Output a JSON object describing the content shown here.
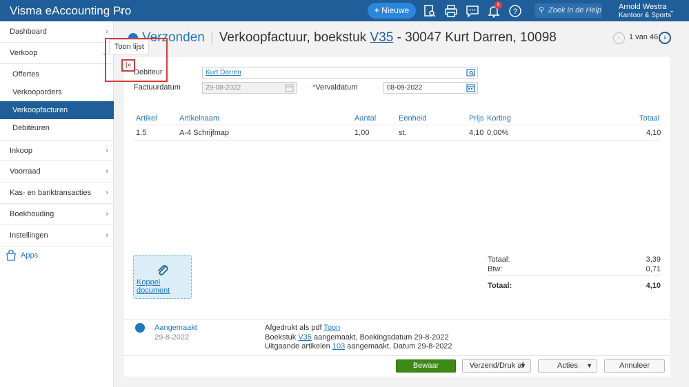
{
  "app": {
    "title": "Visma eAccounting Pro"
  },
  "topbar": {
    "new_label": "Nieuwe",
    "notifications_count": "5",
    "search_placeholder": "Zoek in de Help",
    "user_name": "Arnold Westra",
    "user_org": "Kantoor & Sports"
  },
  "sidebar": {
    "items": [
      {
        "label": "Dashboard"
      },
      {
        "label": "Verkoop"
      },
      {
        "label": "Inkoop"
      },
      {
        "label": "Voorraad"
      },
      {
        "label": "Kas- en banktransacties"
      },
      {
        "label": "Boekhouding"
      },
      {
        "label": "Instellingen"
      }
    ],
    "sub_items": [
      {
        "label": "Offertes"
      },
      {
        "label": "Verkooporders"
      },
      {
        "label": "Verkoopfacturen"
      },
      {
        "label": "Debiteuren"
      }
    ],
    "apps_label": "Apps"
  },
  "tooltip": {
    "text": "Toon lijst"
  },
  "header": {
    "crumb": "Verzonden",
    "title_prefix": "Verkoopfactuur, boekstuk",
    "voucher": "V35",
    "title_suffix": "- 30047 Kurt Darren, 10098",
    "pager": "1 van 46"
  },
  "form": {
    "debiteur_label": "Debiteur",
    "debiteur_value": "Kurt Darren",
    "factuurdatum_label": "Factuurdatum",
    "factuurdatum_value": "29-08-2022",
    "vervaldatum_label": "Vervaldatum",
    "vervaldatum_value": "08-09-2022"
  },
  "table": {
    "headers": [
      "Artikel",
      "Artikelnaam",
      "Aantal",
      "Eenheid",
      "Prijs",
      "Korting",
      "Totaal"
    ],
    "rows": [
      [
        "1.5",
        "A-4 Schrijfmap",
        "1,00",
        "st.",
        "4,10",
        "0,00%",
        "4,10"
      ]
    ]
  },
  "attach": {
    "label": "Koppel document"
  },
  "summary": {
    "subtotal_label": "Totaal:",
    "subtotal_value": "3,39",
    "vat_label": "Btw:",
    "vat_value": "0,71",
    "total_label": "Totaal:",
    "total_value": "4,10"
  },
  "history": {
    "status": "Aangemaakt",
    "date": "29-8-2022",
    "line1_text": "Afgedrukt als pdf",
    "line1_link": "Toon",
    "line2_pre": "Boekstuk",
    "line2_link": "V35",
    "line2_post": "aangemaakt, Boekingsdatum 29-8-2022",
    "line3_pre": "Uitgaande artikelen",
    "line3_link": "103",
    "line3_post": "aangemaakt, Datum 29-8-2022"
  },
  "footer": {
    "save_label": "Bewaar",
    "send_label": "Verzend/Druk af",
    "actions_label": "Acties",
    "cancel_label": "Annuleer"
  },
  "colors": {
    "brand": "#1f5e99",
    "link": "#1f77c3",
    "save": "#3c8a15",
    "highlight": "#d83a3a"
  }
}
